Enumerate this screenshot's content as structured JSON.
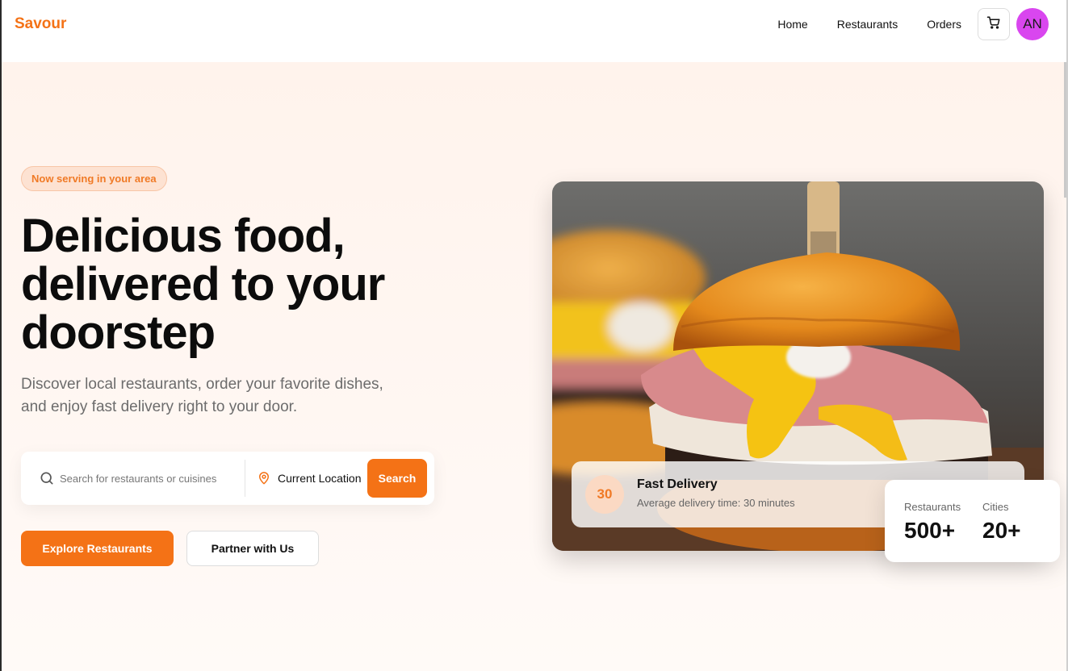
{
  "brand": {
    "name": "Savour",
    "accent": "#f47216"
  },
  "nav": {
    "links": [
      "Home",
      "Restaurants",
      "Orders"
    ],
    "cart_icon": "shopping-cart-icon",
    "avatar_initials": "AN",
    "avatar_color": "#d946ef"
  },
  "hero": {
    "badge": "Now serving in your area",
    "headline": "Delicious food, delivered to your doorstep",
    "subtext": "Discover local restaurants, order your favorite dishes, and enjoy fast delivery right to your door.",
    "search": {
      "placeholder": "Search for restaurants or cuisines",
      "value": "",
      "location_label": "Current Location",
      "button_label": "Search"
    },
    "buttons": {
      "primary": "Explore Restaurants",
      "secondary": "Partner with Us"
    }
  },
  "image_card": {
    "delivery": {
      "badge": "30",
      "title": "Fast Delivery",
      "subtitle": "Average delivery time: 30 minutes"
    },
    "stats": [
      {
        "label": "Restaurants",
        "value": "500+"
      },
      {
        "label": "Cities",
        "value": "20+"
      }
    ]
  }
}
